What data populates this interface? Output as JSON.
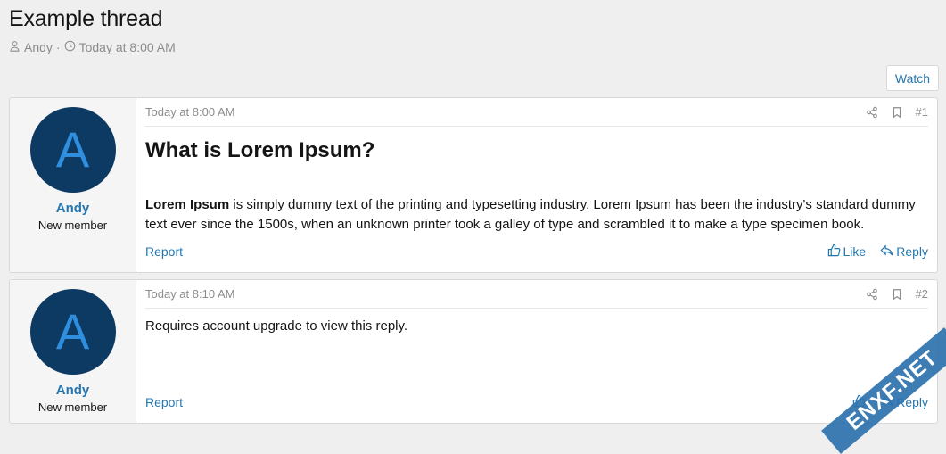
{
  "thread": {
    "title": "Example thread",
    "author": "Andy",
    "separator": "·",
    "date": "Today at 8:00 AM",
    "watch_label": "Watch"
  },
  "posts": [
    {
      "user": {
        "avatar_letter": "A",
        "name": "Andy",
        "title": "New member"
      },
      "date": "Today at 8:00 AM",
      "number": "#1",
      "heading": "What is Lorem Ipsum?",
      "body_bold": "Lorem Ipsum",
      "body_rest": " is simply dummy text of the printing and typesetting industry. Lorem Ipsum has been the industry's standard dummy text ever since the 1500s, when an unknown printer took a galley of type and scrambled it to make a type specimen book.",
      "report_label": "Report",
      "like_label": "Like",
      "reply_label": "Reply"
    },
    {
      "user": {
        "avatar_letter": "A",
        "name": "Andy",
        "title": "New member"
      },
      "date": "Today at 8:10 AM",
      "number": "#2",
      "body": "Requires account upgrade to view this reply.",
      "report_label": "Report",
      "reply_label": "Reply"
    }
  ],
  "watermark": {
    "text": "ENXF.NET"
  },
  "colors": {
    "link": "#2577b1",
    "avatar_bg": "#0d3a63",
    "avatar_letter": "#2f8fde"
  }
}
